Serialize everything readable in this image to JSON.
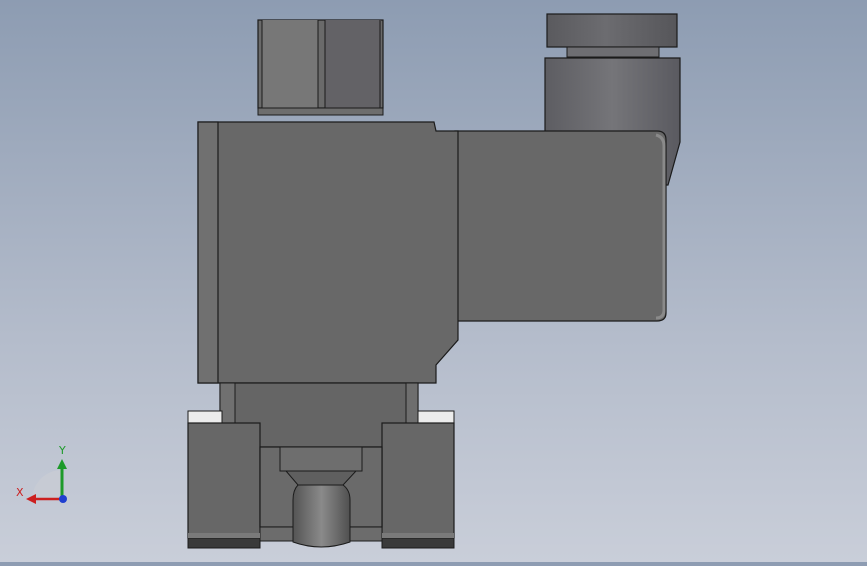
{
  "viewport": {
    "background_top": "#8d9cb2",
    "background_bottom": "#c9ced9",
    "part": "solenoid-valve"
  },
  "triad": {
    "x_label": "X",
    "y_label": "Y",
    "x_color": "#cc1f1f",
    "y_color": "#1d9a2a",
    "z_color": "#1f3fd0"
  },
  "colors": {
    "body_dark": "#676767",
    "body_mid": "#747474",
    "edge": "#1b1b1b",
    "highlight": "#e8e8e8"
  }
}
